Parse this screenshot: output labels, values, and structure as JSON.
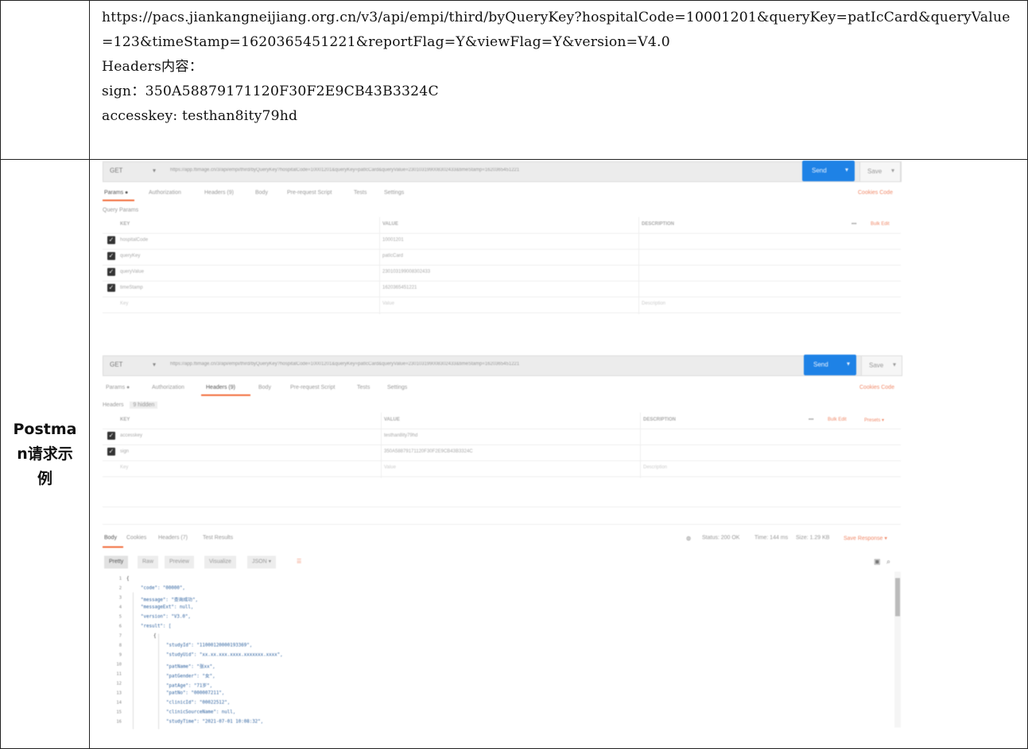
{
  "top_block": {
    "lines": [
      "https://pacs.jiankangneijiang.org.cn/v3/api/empi/third/byQueryKey?hospitalCode=10001201&queryKey=patIcCard&queryValue=123&timeStamp=1620365451221&reportFlag=Y&viewFlag=Y&version=V4.0",
      "Headers内容：",
      "sign：350A58879171120F30F2E9CB43B3324C",
      "accesskey: testhan8ity79hd"
    ]
  },
  "side_label": "Postman请求示例",
  "screenshot": {
    "request1": {
      "method": "GET",
      "url": "https://app.ftimage.cn/3/api/empi/third/byQueryKey?hospitalCode=10001201&queryKey=patIcCard&queryValue=230103199008302433&timeStamp=1620365451221",
      "send": "Send",
      "save": "Save",
      "tabs": [
        "Params ●",
        "Authorization",
        "Headers (9)",
        "Body",
        "Pre-request Script",
        "Tests",
        "Settings"
      ],
      "right_links": "Cookies  Code",
      "section": "Query Params",
      "columns": [
        "KEY",
        "VALUE",
        "DESCRIPTION"
      ],
      "bulk_edit": "Bulk Edit",
      "rows": [
        {
          "key": "hospitalCode",
          "value": "10001201"
        },
        {
          "key": "queryKey",
          "value": "patIcCard"
        },
        {
          "key": "queryValue",
          "value": "230103199008302433"
        },
        {
          "key": "timeStamp",
          "value": "1620365451221"
        }
      ],
      "placeholder_key": "Key",
      "placeholder_value": "Value",
      "placeholder_desc": "Description"
    },
    "request2": {
      "method": "GET",
      "url": "https://app.ftimage.cn/3/api/empi/third/byQueryKey?hospitalCode=10001201&queryKey=patIcCard&queryValue=230103199008302433&timeStamp=1620365451221",
      "send": "Send",
      "save": "Save",
      "tabs": [
        "Params ●",
        "Authorization",
        "Headers (9)",
        "Body",
        "Pre-request Script",
        "Tests",
        "Settings"
      ],
      "right_links": "Cookies  Code",
      "section": "Headers",
      "section_extra": "9 hidden",
      "columns": [
        "KEY",
        "VALUE",
        "DESCRIPTION"
      ],
      "bulk_edit": "Bulk Edit",
      "presets": "Presets ▾",
      "rows": [
        {
          "key": "accesskey",
          "value": "testhan8ity79hd"
        },
        {
          "key": "sign",
          "value": "350A58879171120F30F2E9CB43B3324C"
        }
      ],
      "placeholder_key": "Key",
      "placeholder_value": "Value",
      "placeholder_desc": "Description"
    },
    "response": {
      "tabs": [
        "Body",
        "Cookies",
        "Headers (7)",
        "Test Results"
      ],
      "status": "Status: 200 OK",
      "time": "Time: 144 ms",
      "size": "Size: 1.29 KB",
      "save_response": "Save Response ▾",
      "view_buttons": [
        "Pretty",
        "Raw",
        "Preview",
        "Visualize",
        "JSON ▾"
      ],
      "code_lines": [
        "{",
        "\"code\": \"00000\",",
        "\"message\": \"查询成功\",",
        "\"messageExt\": null,",
        "\"version\": \"V3.0\",",
        "\"result\": [",
        "{",
        "\"studyId\": \"11000120000193369\",",
        "\"studyUid\": \"xx.xx.xxx.xxxx.xxxxxxx.xxxx\",",
        "\"patName\": \"张xx\",",
        "\"patGender\": \"女\",",
        "\"patAge\": \"71岁\",",
        "\"patNo\": \"000007211\",",
        "\"clinicId\": \"00022512\",",
        "\"clinicSourceName\": null,",
        "\"studyTime\": \"2021-07-01 10:08:32\","
      ]
    }
  }
}
